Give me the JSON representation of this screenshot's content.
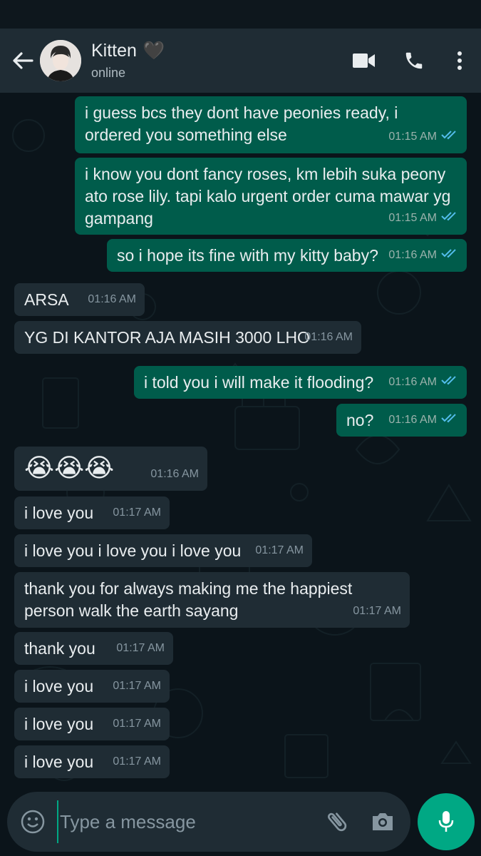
{
  "header": {
    "contact_name": "Kitten",
    "contact_emoji": "🖤",
    "status": "online",
    "icons": [
      "back-arrow-icon",
      "video-call-icon",
      "voice-call-icon",
      "more-options-icon"
    ]
  },
  "messages": [
    {
      "dir": "out",
      "text": "i guess bcs they dont have peonies ready, i ordered you something else",
      "time": "01:15 AM",
      "read": true
    },
    {
      "dir": "out",
      "text": "i know you dont fancy roses, km lebih suka peony ato rose lily. tapi kalo urgent order cuma mawar yg gampang",
      "time": "01:15 AM",
      "read": true
    },
    {
      "dir": "out",
      "text": "so i hope its fine with my kitty baby?",
      "time": "01:16 AM",
      "read": true
    },
    {
      "dir": "in",
      "text": "ARSA",
      "time": "01:16 AM"
    },
    {
      "dir": "in",
      "text": "YG DI KANTOR AJA MASIH 3000 LHO",
      "time": "01:16 AM"
    },
    {
      "dir": "out",
      "text": "i told you i will make it flooding?",
      "time": "01:16 AM",
      "read": true
    },
    {
      "dir": "out",
      "text": "no?",
      "time": "01:16 AM",
      "read": true
    },
    {
      "dir": "in",
      "text": "😭😭😭",
      "time": "01:16 AM"
    },
    {
      "dir": "in",
      "text": "i love you",
      "time": "01:17 AM"
    },
    {
      "dir": "in",
      "text": "i love you i love you i love you",
      "time": "01:17 AM"
    },
    {
      "dir": "in",
      "text": "thank you for always making me the happiest person walk the earth sayang",
      "time": "01:17 AM"
    },
    {
      "dir": "in",
      "text": "thank you",
      "time": "01:17 AM"
    },
    {
      "dir": "in",
      "text": "i love you",
      "time": "01:17 AM"
    },
    {
      "dir": "in",
      "text": "i love you",
      "time": "01:17 AM"
    },
    {
      "dir": "in",
      "text": "i love you",
      "time": "01:17 AM"
    }
  ],
  "composer": {
    "placeholder": "Type a message"
  },
  "colors": {
    "header_bg": "#1f2c34",
    "chat_bg": "#0b141a",
    "outgoing_bubble": "#005c4b",
    "incoming_bubble": "#1f2c34",
    "accent": "#00a884",
    "read_tick": "#53bdeb"
  }
}
